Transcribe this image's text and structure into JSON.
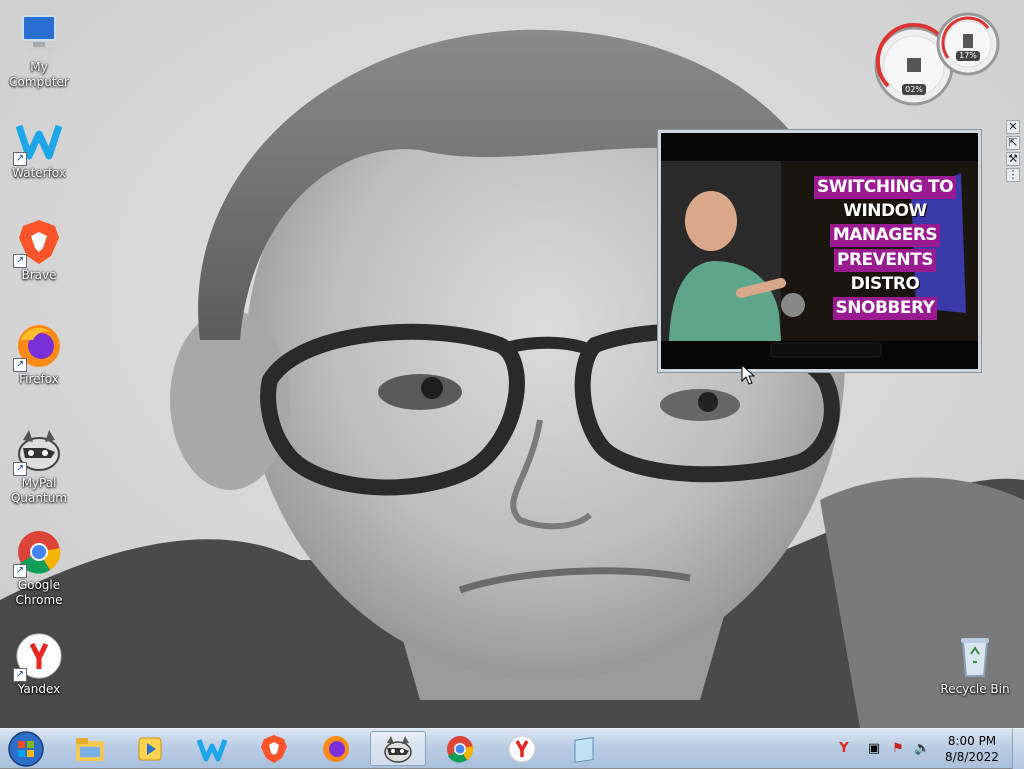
{
  "desktop": {
    "icons": [
      {
        "label": "My Computer",
        "icon": "computer-icon"
      },
      {
        "label": "Waterfox",
        "icon": "waterfox-icon"
      },
      {
        "label": "Brave",
        "icon": "brave-icon"
      },
      {
        "label": "Firefox",
        "icon": "firefox-icon"
      },
      {
        "label": "MyPal Quantum",
        "icon": "raccoon-icon"
      },
      {
        "label": "Google Chrome",
        "icon": "chrome-icon"
      },
      {
        "label": "Yandex",
        "icon": "yandex-icon"
      },
      {
        "label": "Recycle Bin",
        "icon": "recycle-bin-icon"
      }
    ]
  },
  "gadget": {
    "cpu": "02%",
    "memory": "17%"
  },
  "media": {
    "title_lines": [
      "SWITCHING TO",
      "WINDOW",
      "MANAGERS",
      "PREVENTS",
      "DISTRO",
      "SNOBBERY"
    ],
    "tools": [
      "close-icon",
      "popout-icon",
      "wrench-icon",
      "drag-icon"
    ]
  },
  "taskbar": {
    "pinned": [
      "start-orb-icon",
      "explorer-icon",
      "media-player-icon",
      "waterfox-icon",
      "brave-icon",
      "firefox-icon",
      "raccoon-icon",
      "chrome-icon",
      "yandex-icon",
      "notepad-icon"
    ],
    "tray": [
      "yandex-tray-icon",
      "network-icon",
      "action-center-icon",
      "volume-icon"
    ],
    "time": "8:00 PM",
    "date": "8/8/2022"
  }
}
